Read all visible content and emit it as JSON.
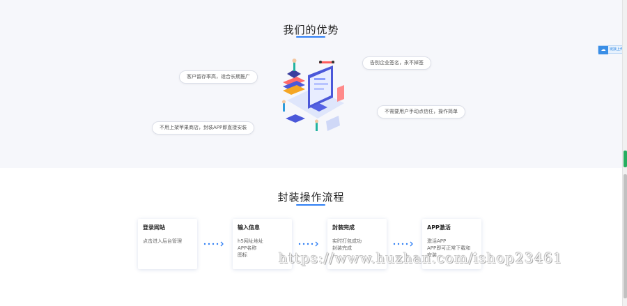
{
  "advantages": {
    "title": "我们的优势",
    "pills": [
      "客户留存率高，适合长期推广",
      "告别企业签名，永不掉签",
      "不需要用户手动点信任，操作简单",
      "不用上架苹果商店，封装APP即直接安装"
    ]
  },
  "flow": {
    "title": "封装操作流程",
    "steps": [
      {
        "title": "登录网站",
        "lines": [
          "点击进入后台管理"
        ]
      },
      {
        "title": "输入信息",
        "lines": [
          "h5网址地址",
          "APP名称",
          "图标"
        ]
      },
      {
        "title": "封装完成",
        "lines": [
          "实时打包成功",
          "封装完成"
        ]
      },
      {
        "title": "APP激活",
        "lines": [
          "激活APP",
          "APP即可正常下载和",
          "安装"
        ]
      }
    ]
  },
  "side_tab": {
    "label": "链接上传"
  },
  "watermark": "https://www.huzhan.com/ishop23461",
  "colors": {
    "accent": "#2f7ff5",
    "section_bg": "#f6f7fb"
  }
}
